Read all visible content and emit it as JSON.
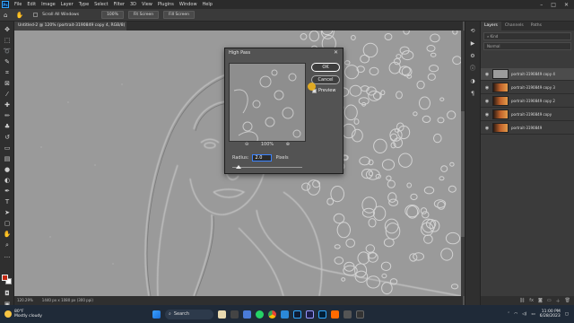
{
  "menubar": {
    "app_icon": "Ps",
    "items": [
      "File",
      "Edit",
      "Image",
      "Layer",
      "Type",
      "Select",
      "Filter",
      "3D",
      "View",
      "Plugins",
      "Window",
      "Help"
    ]
  },
  "options_bar": {
    "scroll_all_windows": "Scroll All Windows",
    "zoom": "100%",
    "fit_screen": "Fit Screen",
    "fill_screen": "Fill Screen"
  },
  "document": {
    "tab_title": "Untitled-2 @ 120% (portrait-3190849 copy 4, RGB/8) *"
  },
  "status_bar": {
    "zoom": "120.29%",
    "dimensions": "1440 px x 1080 px (300 ppi)"
  },
  "dialog": {
    "title": "High Pass",
    "ok_label": "OK",
    "cancel_label": "Cancel",
    "preview_label": "Preview",
    "zoom_value": "100%",
    "radius_label": "Radius:",
    "radius_value": "2.0",
    "radius_unit": "Pixels"
  },
  "layers_panel": {
    "tabs": [
      "Layers",
      "Channels",
      "Paths"
    ],
    "search_placeholder": "Kind",
    "blend_mode": "Normal",
    "layers": [
      {
        "name": "portrait-3190849 copy 4",
        "selected": true
      },
      {
        "name": "portrait-3190849 copy 3",
        "selected": false
      },
      {
        "name": "portrait-3190849 copy 2",
        "selected": false
      },
      {
        "name": "portrait-3190849 copy",
        "selected": false
      },
      {
        "name": "portrait-3190849",
        "selected": false
      }
    ]
  },
  "taskbar": {
    "weather_temp": "80°F",
    "weather_desc": "Mostly cloudy",
    "search_label": "Search",
    "time": "11:00 PM",
    "date": "6/28/2023"
  },
  "colors": {
    "accent": "#31a8ff",
    "foreground_swatch": "#c3260f",
    "background_swatch": "#ffffff"
  }
}
